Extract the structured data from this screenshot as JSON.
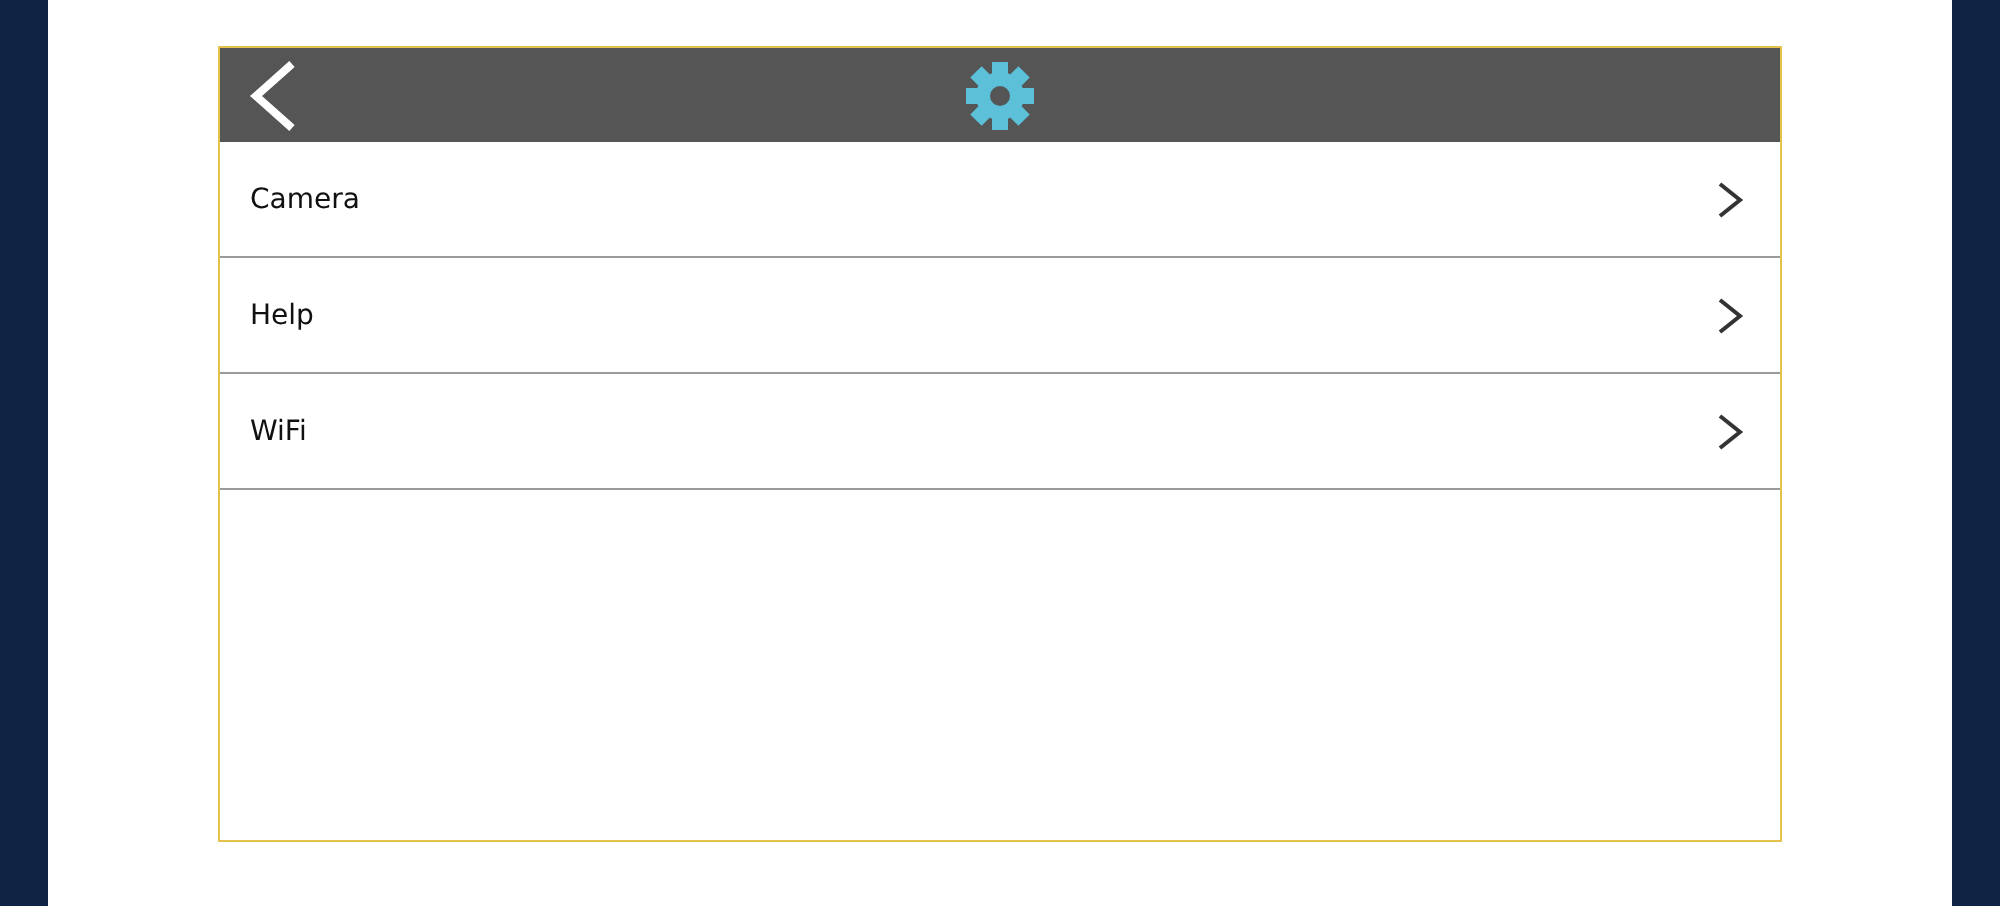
{
  "settings_menu": {
    "items": [
      {
        "label": "Camera"
      },
      {
        "label": "Help"
      },
      {
        "label": "WiFi"
      }
    ]
  }
}
